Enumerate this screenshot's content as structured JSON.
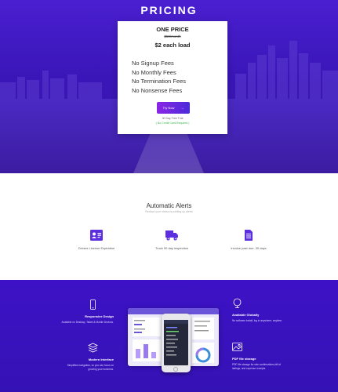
{
  "hero": {
    "title": "PRICING",
    "card": {
      "title": "ONE PRICE",
      "old_price": "$50/month",
      "price": "$2 each load",
      "features": [
        "No Signup Fees",
        "No Monthly Fees",
        "No Termination Fees",
        "No Nonsense Fees"
      ],
      "cta_label": "Try Now",
      "cta_arrow": "→",
      "trial_text": "30 Day Free Trial",
      "no_card_text": "( No Credit Card Required )"
    }
  },
  "alerts": {
    "title": "Automatic Alerts",
    "subtitle": "Reduce your stress by setting up alerts",
    "items": [
      {
        "label": "Drivers License Expiration",
        "icon": "id-card-icon"
      },
      {
        "label": "Truck 90 day inspection",
        "icon": "truck-icon"
      },
      {
        "label": "Invoice past due, 30 days",
        "icon": "document-icon"
      }
    ]
  },
  "features": {
    "items": [
      {
        "title": "Responsive Design",
        "desc": "Available on Desktop, Tablet & Mobile Devices.",
        "icon": "mobile-icon"
      },
      {
        "title": "Modern Interface",
        "desc": "Simplified navigation, so you can focus on growing your business.",
        "icon": "layers-icon"
      },
      {
        "title": "Available Globally",
        "desc": "No software install, log in anywhere, anytime.",
        "icon": "globe-icon"
      },
      {
        "title": "PDF file storage",
        "desc": "PDF file storage for rate confirmations,bill of ladings, and expense receipts.",
        "icon": "image-icon"
      }
    ]
  },
  "colors": {
    "brand_purple": "#3d12c6",
    "button_gradient_start": "#8b25e6",
    "button_gradient_end": "#4a2bd9",
    "success_green": "#3bb54a"
  }
}
